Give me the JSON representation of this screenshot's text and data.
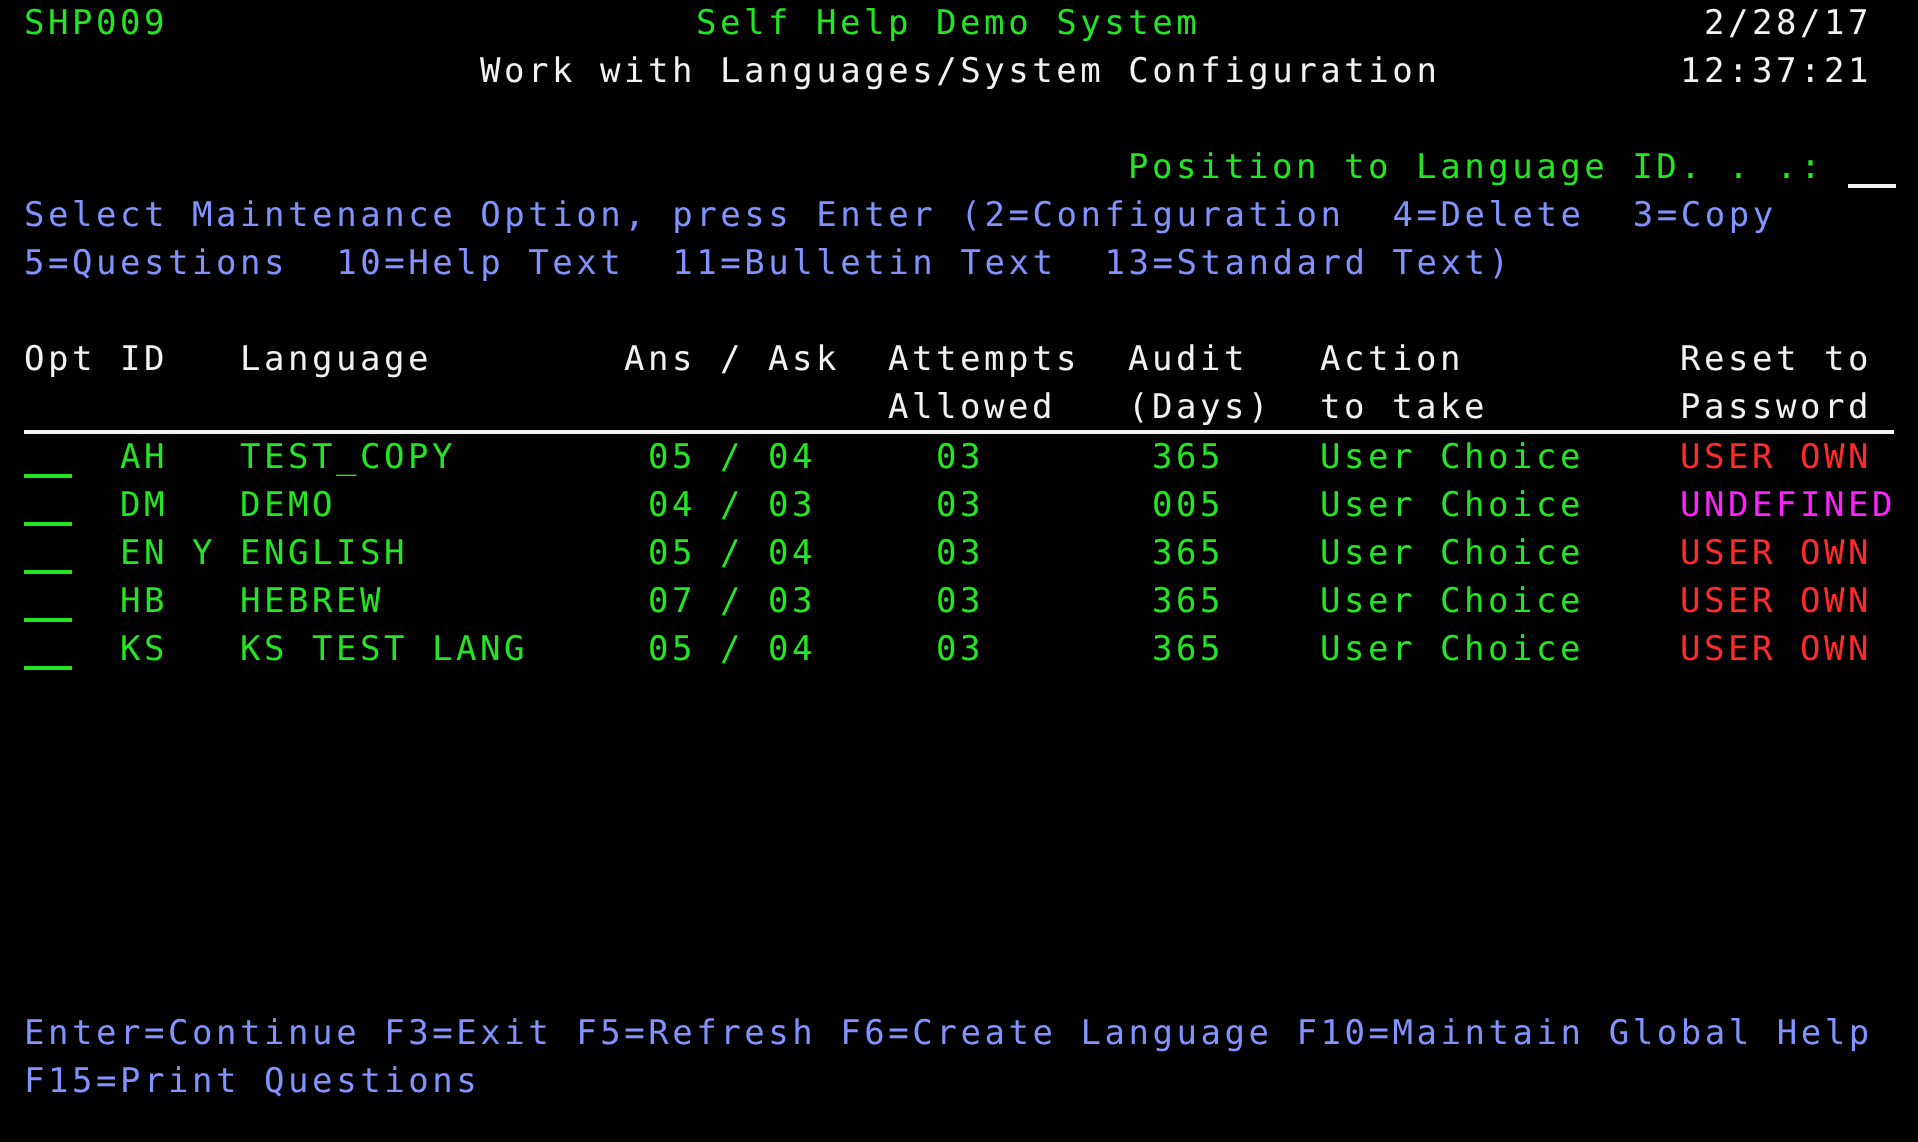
{
  "header": {
    "program_id": "SHP009",
    "system_name": "Self Help Demo System",
    "date": "2/28/17",
    "screen_title": "Work with Languages/System Configuration",
    "time": "12:37:21"
  },
  "position_field": {
    "label": "Position to Language ID. . .:"
  },
  "instructions": [
    "Select Maintenance Option, press Enter (2=Configuration  4=Delete  3=Copy",
    "5=Questions  10=Help Text  11=Bulletin Text  13=Standard Text)"
  ],
  "columns": [
    [
      "Opt"
    ],
    [
      "ID"
    ],
    [
      "Language"
    ],
    [
      "Ans / Ask"
    ],
    [
      "Attempts",
      "Allowed"
    ],
    [
      "Audit",
      "(Days)"
    ],
    [
      "Action",
      "to take"
    ],
    [
      "Reset to",
      "Password"
    ]
  ],
  "rows": [
    {
      "id": "AH",
      "language": "TEST_COPY",
      "ans_ask": "05 / 04",
      "attempts": "03",
      "audit": "365",
      "action": "User Choice",
      "reset": "USER OWN",
      "color": "#ff2a2a"
    },
    {
      "id": "DM",
      "language": "DEMO",
      "ans_ask": "04 / 03",
      "attempts": "03",
      "audit": "005",
      "action": "User Choice",
      "reset": "UNDEFINED",
      "color": "#ff22ff"
    },
    {
      "id": "EN",
      "marker": "Y",
      "language": "ENGLISH",
      "ans_ask": "05 / 04",
      "attempts": "03",
      "audit": "365",
      "action": "User Choice",
      "reset": "USER OWN",
      "color": "#ff2a2a"
    },
    {
      "id": "HB",
      "language": "HEBREW",
      "ans_ask": "07 / 03",
      "attempts": "03",
      "audit": "365",
      "action": "User Choice",
      "reset": "USER OWN",
      "color": "#ff2a2a"
    },
    {
      "id": "KS",
      "language": "KS TEST LANG",
      "ans_ask": "05 / 04",
      "attempts": "03",
      "audit": "365",
      "action": "User Choice",
      "reset": "USER OWN",
      "color": "#ff2a2a"
    }
  ],
  "function_keys": [
    "Enter=Continue F3=Exit F5=Refresh F6=Create Language F10=Maintain Global Help",
    "F15=Print Questions"
  ]
}
